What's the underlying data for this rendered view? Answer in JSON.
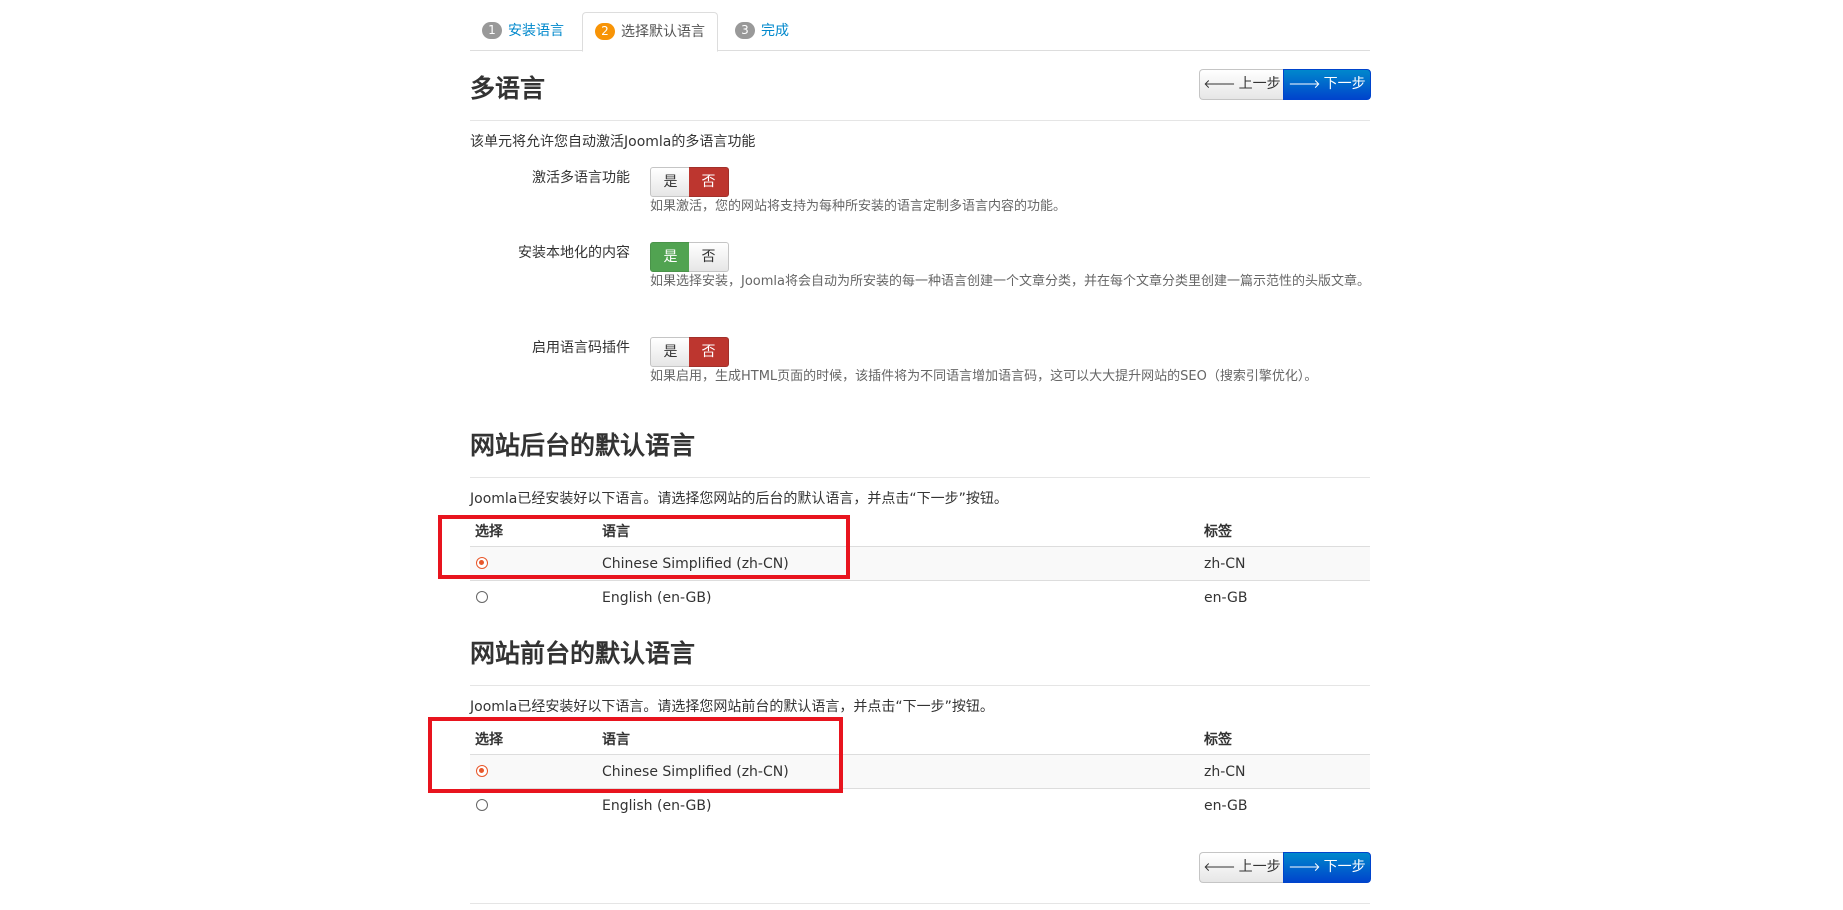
{
  "tabs": [
    {
      "num": "1",
      "label": "安装语言"
    },
    {
      "num": "2",
      "label": "选择默认语言"
    },
    {
      "num": "3",
      "label": "完成"
    }
  ],
  "nav": {
    "prev_label": "上一步",
    "next_label": "下一步"
  },
  "multilang": {
    "title": "多语言",
    "description": "该单元将允许您自动激活Joomla的多语言功能",
    "yes": "是",
    "no": "否",
    "fields": [
      {
        "label": "激活多语言功能",
        "help": "如果激活，您的网站将支持为每种所安装的语言定制多语言内容的功能。",
        "value": "no"
      },
      {
        "label": "安装本地化的内容",
        "help": "如果选择安装，Joomla将会自动为所安装的每一种语言创建一个文章分类，并在每个文章分类里创建一篇示范性的头版文章。",
        "value": "yes"
      },
      {
        "label": "启用语言码插件",
        "help": "如果启用，生成HTML页面的时候，该插件将为不同语言增加语言码，这可以大大提升网站的SEO（搜索引擎优化）。",
        "value": "no"
      }
    ]
  },
  "admin": {
    "title": "网站后台的默认语言",
    "description": "Joomla已经安装好以下语言。请选择您网站的后台的默认语言，并点击“下一步”按钮。",
    "headers": {
      "select": "选择",
      "language": "语言",
      "tag": "标签"
    },
    "rows": [
      {
        "language": "Chinese Simplified (zh-CN)",
        "tag": "zh-CN",
        "selected": true
      },
      {
        "language": "English (en-GB)",
        "tag": "en-GB",
        "selected": false
      }
    ]
  },
  "site": {
    "title": "网站前台的默认语言",
    "description": "Joomla已经安装好以下语言。请选择您网站前台的默认语言，并点击“下一步”按钮。",
    "headers": {
      "select": "选择",
      "language": "语言",
      "tag": "标签"
    },
    "rows": [
      {
        "language": "Chinese Simplified (zh-CN)",
        "tag": "zh-CN",
        "selected": true
      },
      {
        "language": "English (en-GB)",
        "tag": "en-GB",
        "selected": false
      }
    ]
  },
  "colors": {
    "highlight_box": "#e8141e",
    "active_step": "#f89406",
    "no_active": "#bd362f",
    "yes_active": "#51a351",
    "next_button": "#0044cc"
  }
}
